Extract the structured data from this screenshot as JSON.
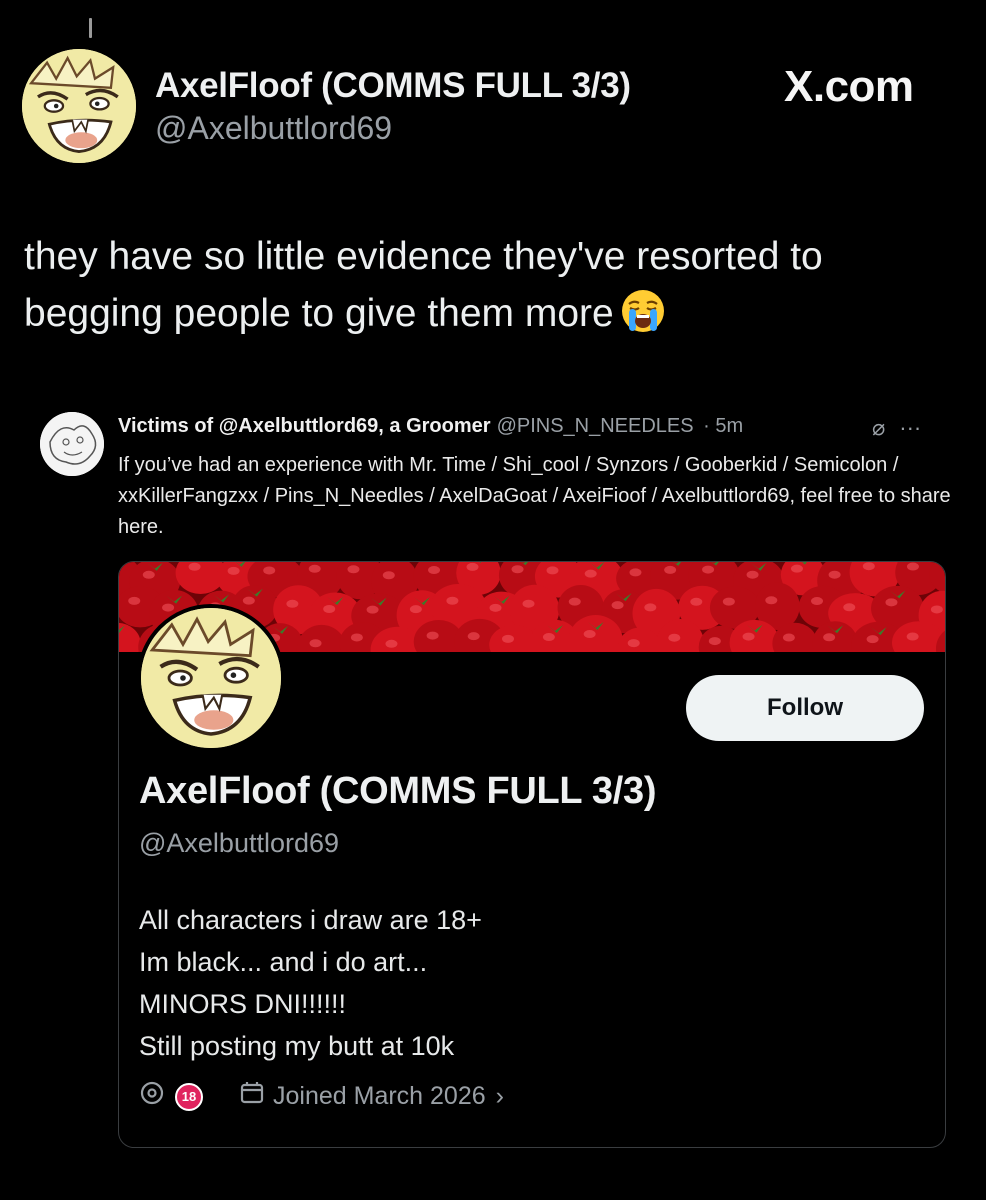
{
  "post": {
    "display_name": "AxelFloof (COMMS FULL 3/3)",
    "handle": "@Axelbuttlord69",
    "site_logo": "X.com",
    "text": "they have so little evidence they've resorted to begging people to give them more",
    "emoji": "loudly-crying-face"
  },
  "quote": {
    "display_name": "Victims of @Axelbuttlord69, a Groomer",
    "handle": "@PINS_N_NEEDLES",
    "time": "· 5m",
    "more_icon": "···",
    "text": "If you’ve had an experience with Mr. Time / Shi_cool / Synzors / Gooberkid / Semicolon / xxKillerFangzxx / Pins_N_Needles / AxelDaGoat / AxeiFioof / Axelbuttlord69, feel free to share here."
  },
  "profile_card": {
    "follow_label": "Follow",
    "display_name": "AxelFloof (COMMS FULL 3/3)",
    "handle": "@Axelbuttlord69",
    "bio": [
      "All characters i draw are 18+",
      "Im black... and i do art...",
      "MINORS DNI!!!!!!",
      "Still posting my butt at 10k"
    ],
    "age_badge": "18",
    "joined": "Joined March 2026",
    "joined_chevron": "›"
  },
  "colors": {
    "background": "#000000",
    "banner_red": "#c8101a",
    "follow_bg": "#eff3f4",
    "muted_text": "#9aa0a6",
    "age_badge": "#e0245e"
  }
}
